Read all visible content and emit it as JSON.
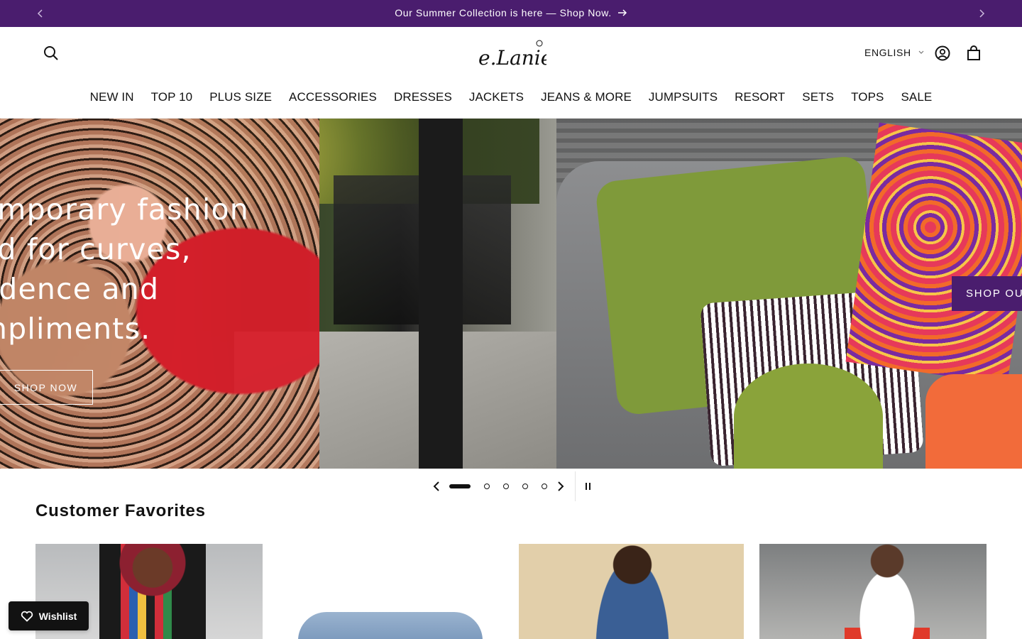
{
  "announcement": {
    "message": "Our Summer Collection is here — Shop Now.",
    "prev_icon": "chevron-left-icon",
    "next_icon": "chevron-right-icon",
    "background": "#4a1d6e"
  },
  "header": {
    "logo_text": "e.Laniese",
    "language": "ENGLISH",
    "icons": [
      "search-icon",
      "account-icon",
      "cart-icon"
    ]
  },
  "nav": {
    "items": [
      "NEW IN",
      "TOP 10",
      "PLUS SIZE",
      "ACCESSORIES",
      "DRESSES",
      "JACKETS",
      "JEANS & MORE",
      "JUMPSUITS",
      "RESORT",
      "SETS",
      "TOPS",
      "SALE"
    ]
  },
  "hero": {
    "slide1": {
      "headline_lines": [
        "emporary fashion",
        "ed for curves,",
        "fidence and",
        "mpliments."
      ],
      "button": "SHOP NOW"
    },
    "slide2": {
      "button": "SHOP OU"
    }
  },
  "slider": {
    "total_slides": 5,
    "active_index": 0,
    "icons": [
      "chevron-left-icon",
      "chevron-right-icon",
      "pause-icon"
    ]
  },
  "collection": {
    "title": "Customer Favorites"
  },
  "wishlist": {
    "label": "Wishlist",
    "icon": "heart-icon"
  },
  "colors": {
    "brand_purple": "#4a1d6e",
    "text": "#121212"
  }
}
